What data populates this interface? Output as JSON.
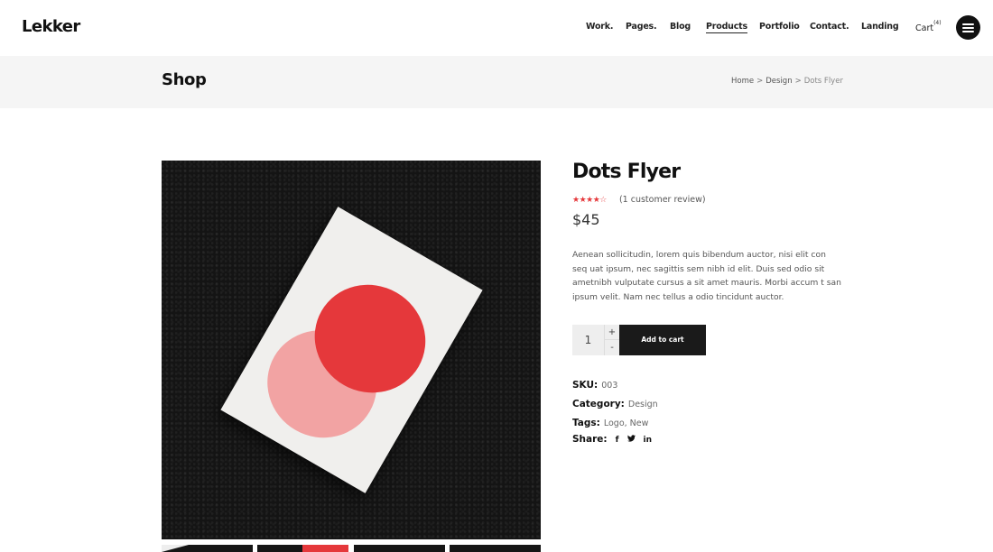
{
  "header": {
    "logo": "Lekker",
    "nav": [
      "Work.",
      "Pages.",
      "Blog",
      "Products",
      "Portfolio",
      "Contact.",
      "Landing"
    ],
    "active_nav": "Products",
    "cart_label": "Cart",
    "cart_count": "(4)",
    "menu_icon": "hamburger-icon"
  },
  "title_bar": {
    "title": "Shop",
    "breadcrumb": [
      "Home",
      "Design",
      "Dots Flyer"
    ],
    "separator": ">"
  },
  "product": {
    "title": "Dots Flyer",
    "rating": 4,
    "rating_max": 5,
    "stars": "★★★★",
    "star_empty": "☆",
    "review_text": "(1 customer review)",
    "price": "$45",
    "description": "Aenean sollicitudin, lorem quis bibendum auctor, nisi elit con seq uat ipsum, nec sagittis sem nibh id elit. Duis sed odio sit ametnibh vulputate cursus a sit amet mauris. Morbi accum t san ipsum velit. Nam nec tellus a odio tincidunt auctor.",
    "quantity": "1",
    "plus": "+",
    "minus": "-",
    "add_to_cart": "Add to cart",
    "sku_label": "SKU:",
    "sku": "003",
    "category_label": "Category:",
    "category": "Design",
    "tags_label": "Tags:",
    "tags": "Logo, New",
    "share_label": "Share:",
    "share_icons": [
      "f",
      "t",
      "in"
    ],
    "colors": {
      "accent": "#e5383b",
      "pink": "#f2a3a3",
      "dark": "#1a1a1a"
    }
  }
}
